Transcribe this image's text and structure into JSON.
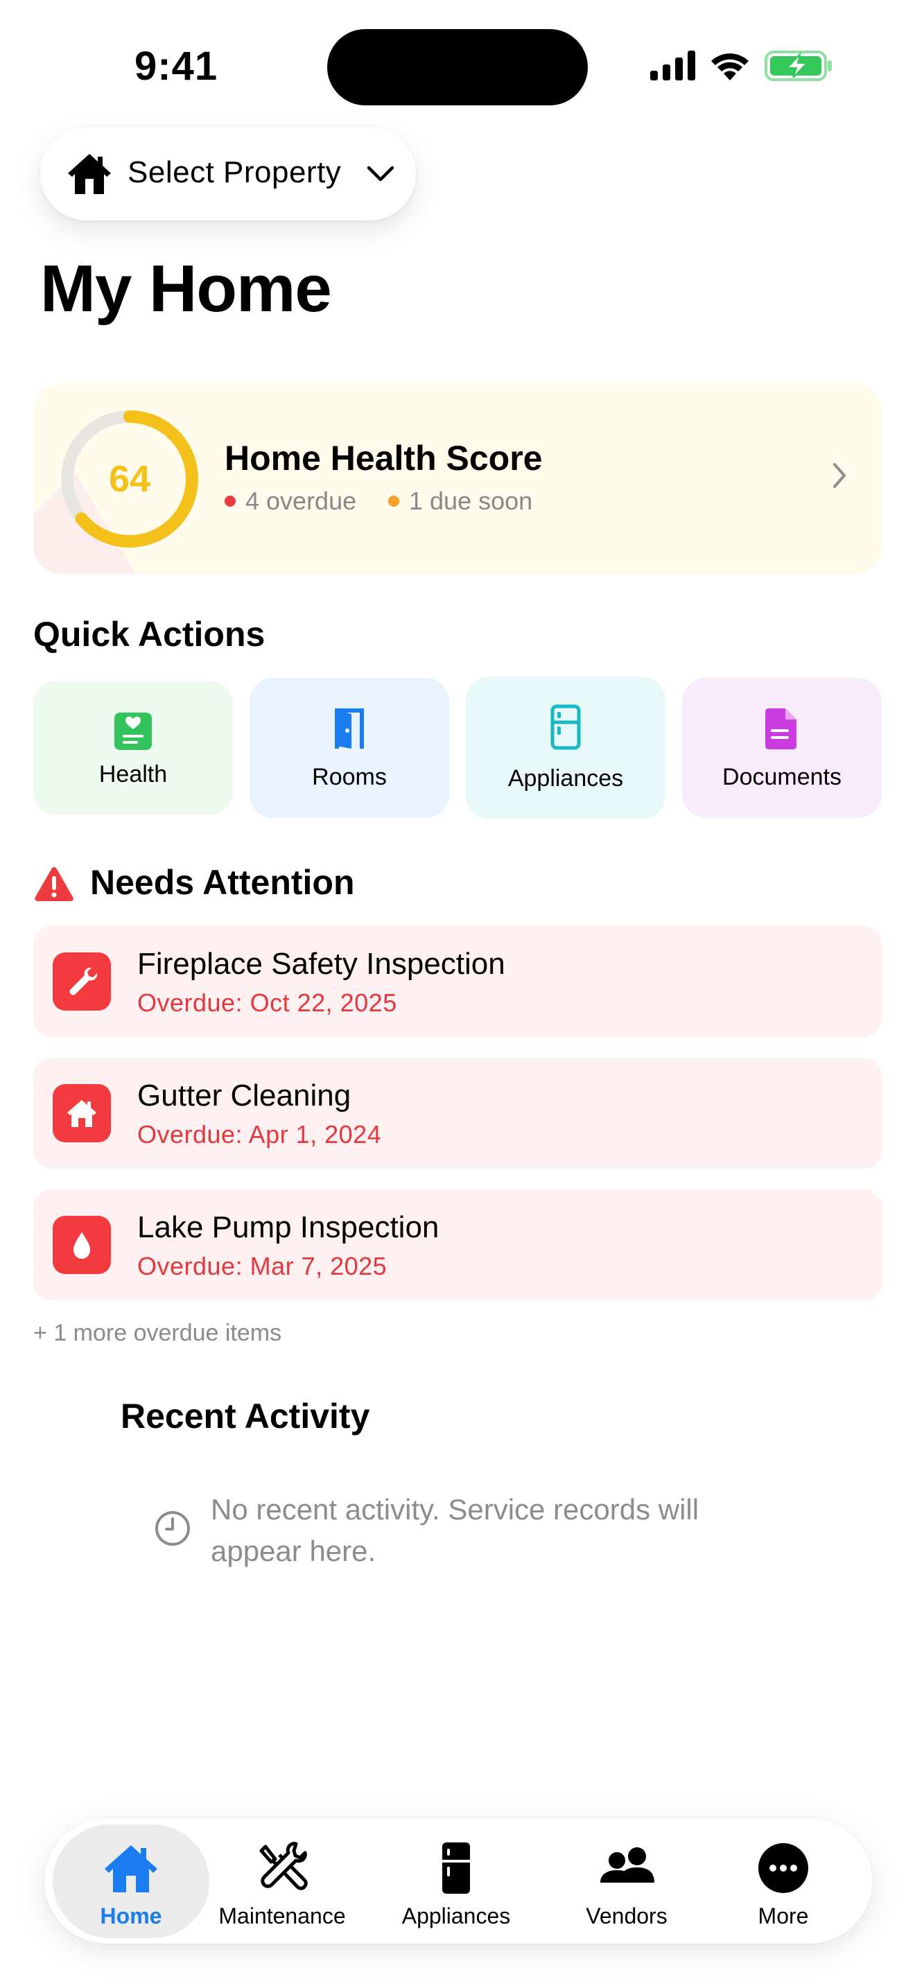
{
  "status_bar": {
    "time": "9:41"
  },
  "property_selector": {
    "label": "Select Property"
  },
  "page": {
    "title": "My Home"
  },
  "health_card": {
    "score": "64",
    "score_fraction": 0.64,
    "title": "Home Health Score",
    "overdue": "4 overdue",
    "due_soon": "1 due soon",
    "colors": {
      "ring": "#f3c11a",
      "overdue_dot": "#ee3b3f",
      "due_soon_dot": "#f5a12a"
    }
  },
  "quick_actions": {
    "title": "Quick Actions",
    "items": [
      {
        "label": "Health",
        "icon": "health-card-icon",
        "bg": "#eef9ef",
        "color": "#33c35c"
      },
      {
        "label": "Rooms",
        "icon": "door-icon",
        "bg": "#e8f3ff",
        "color": "#1a7cf0"
      },
      {
        "label": "Appliances",
        "icon": "refrigerator-icon",
        "bg": "#e7f8f8",
        "color": "#19b9c4"
      },
      {
        "label": "Documents",
        "icon": "document-icon",
        "bg": "#f8ecfc",
        "color": "#cb3ce0"
      }
    ]
  },
  "needs_attention": {
    "title": "Needs Attention",
    "items": [
      {
        "name": "Fireplace Safety Inspection",
        "due": "Overdue: Oct 22, 2025",
        "icon": "wrench-icon"
      },
      {
        "name": "Gutter Cleaning",
        "due": "Overdue: Apr 1, 2024",
        "icon": "house-icon"
      },
      {
        "name": "Lake Pump Inspection",
        "due": "Overdue: Mar 7, 2025",
        "icon": "drop-icon"
      }
    ],
    "more": "+ 1 more overdue items"
  },
  "recent_activity": {
    "title": "Recent Activity",
    "empty_line1": "No recent activity. Service records will",
    "empty_line2": "appear here."
  },
  "tab_bar": {
    "tabs": [
      {
        "label": "Home",
        "icon": "house-icon",
        "active": true
      },
      {
        "label": "Maintenance",
        "icon": "tools-icon"
      },
      {
        "label": "Appliances",
        "icon": "refrigerator-icon"
      },
      {
        "label": "Vendors",
        "icon": "people-icon"
      },
      {
        "label": "More",
        "icon": "ellipsis-circle-icon"
      }
    ],
    "active_color": "#1a7cf0"
  }
}
